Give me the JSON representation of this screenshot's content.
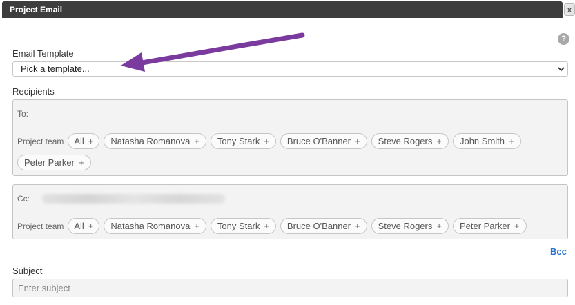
{
  "dialog": {
    "title": "Project Email",
    "close_label": "x",
    "help_label": "?"
  },
  "template": {
    "label": "Email Template",
    "selected": "Pick a template..."
  },
  "recipients": {
    "label": "Recipients",
    "to_label": "To:",
    "cc_label": "Cc:",
    "group_label": "Project team",
    "to_chips": [
      "All",
      "Natasha Romanova",
      "Tony Stark",
      "Bruce O'Banner",
      "Steve Rogers",
      "John Smith",
      "Peter Parker"
    ],
    "cc_chips": [
      "All",
      "Natasha Romanova",
      "Tony Stark",
      "Bruce O'Banner",
      "Steve Rogers",
      "Peter Parker"
    ],
    "chip_plus": "+"
  },
  "bcc_label": "Bcc",
  "subject": {
    "label": "Subject",
    "placeholder": "Enter subject"
  },
  "colors": {
    "titlebar": "#3d3d3d",
    "link": "#2576d2",
    "arrow": "#7a3a9e"
  },
  "icons": [
    "close-icon",
    "help-icon",
    "chevron-down-icon",
    "annotation-arrow"
  ]
}
